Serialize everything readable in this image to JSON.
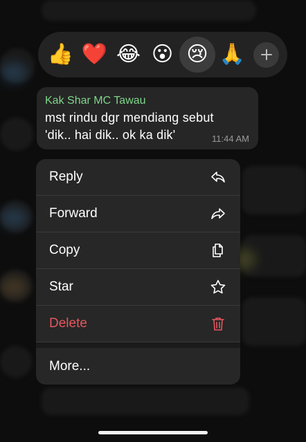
{
  "reactions": {
    "emojis": [
      {
        "name": "thumbs-up",
        "glyph": "👍"
      },
      {
        "name": "red-heart",
        "glyph": "❤️"
      },
      {
        "name": "tears-of-joy",
        "glyph": "😂"
      },
      {
        "name": "surprised",
        "glyph": "😮"
      },
      {
        "name": "crying",
        "glyph": "😢"
      },
      {
        "name": "praying-hands",
        "glyph": "🙏"
      }
    ],
    "selected": "crying",
    "more_icon": "plus-icon"
  },
  "message": {
    "sender": "Kak Shar MC Tawau",
    "text_line1": "mst rindu dgr mendiang sebut",
    "text_line2": "'dik.. hai dik.. ok ka dik'",
    "time": "11:44 AM",
    "sender_color": "#7ed68a"
  },
  "menu": {
    "reply": "Reply",
    "forward": "Forward",
    "copy": "Copy",
    "star": "Star",
    "delete": "Delete",
    "more": "More...",
    "danger_color": "#e5575e"
  }
}
